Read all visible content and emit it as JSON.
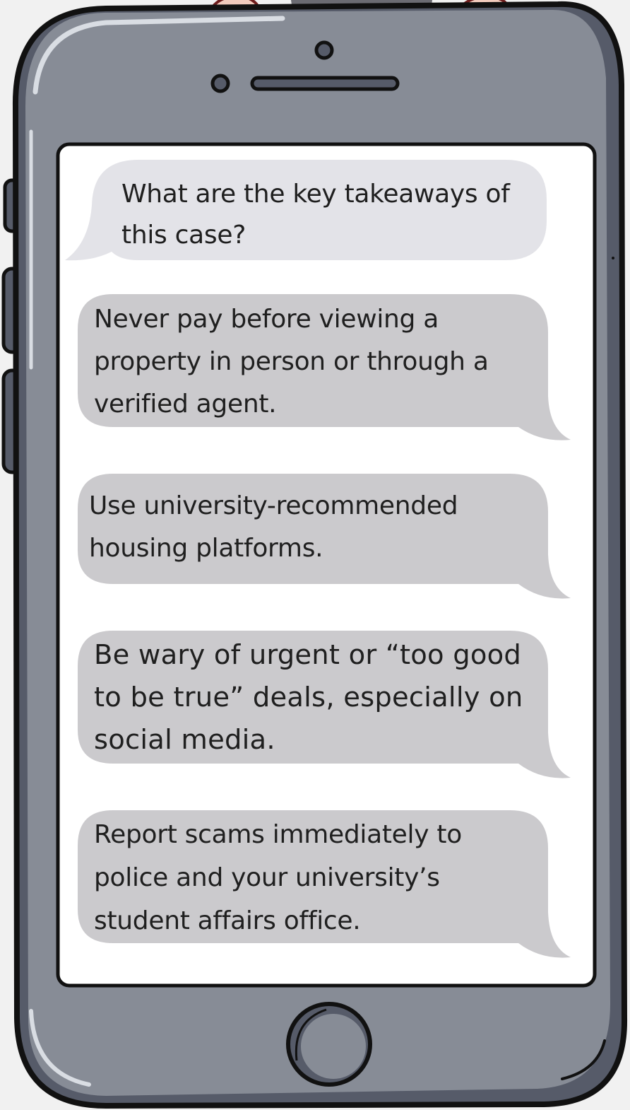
{
  "colors": {
    "background": "#f1f1f1",
    "phone_body": "#878c96",
    "phone_edge": "#565b69",
    "screen": "#ffffff",
    "question_bubble": "#e3e3e8",
    "answer_bubble": "#cbcacd",
    "outline": "#111111"
  },
  "icons": {
    "front_camera": "camera-icon",
    "home_button": "home-button-icon"
  },
  "chat": {
    "question": "What are the key takeaways of this case?",
    "answers": [
      "Never pay before viewing a property in person or through a verified agent.",
      "Use university-recommended housing platforms.",
      "Be wary of urgent or “too good to be true” deals, especially on social media.",
      "Report scams immediately to police and your university’s student affairs office."
    ]
  }
}
